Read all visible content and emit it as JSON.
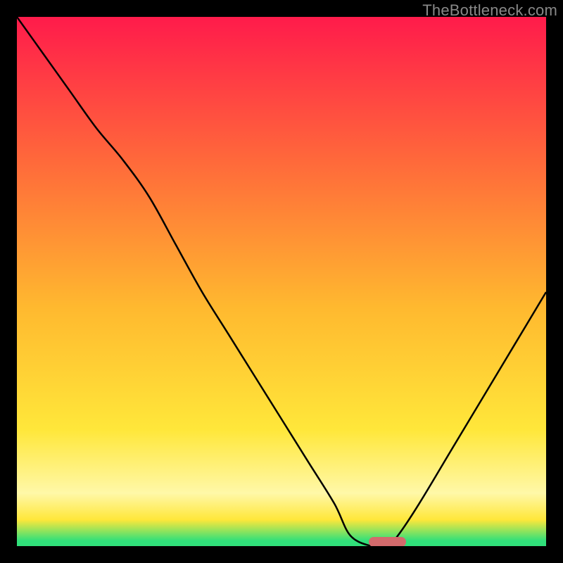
{
  "watermark": "TheBottleneck.com",
  "colors": {
    "top": "#ff1b4b",
    "mid1": "#ff6b3a",
    "mid2": "#ffb92f",
    "yellow": "#ffe73a",
    "pale": "#fff8a8",
    "green": "#30e07a",
    "marker": "#d36a6c",
    "curve": "#000000",
    "frame": "#000000"
  },
  "marker": {
    "x_pct": 66.5,
    "width_pct": 7.0
  },
  "chart_data": {
    "type": "line",
    "title": "",
    "xlabel": "",
    "ylabel": "",
    "xlim": [
      0,
      100
    ],
    "ylim": [
      0,
      100
    ],
    "legend": false,
    "grid": false,
    "series": [
      {
        "name": "curve",
        "x": [
          0,
          5,
          10,
          15,
          20,
          25,
          30,
          35,
          40,
          45,
          50,
          55,
          60,
          63,
          67,
          70,
          72,
          76,
          82,
          88,
          94,
          100
        ],
        "y": [
          100,
          93,
          86,
          79,
          73,
          66,
          57,
          48,
          40,
          32,
          24,
          16,
          8,
          2,
          0,
          0,
          2,
          8,
          18,
          28,
          38,
          48
        ]
      }
    ],
    "floor_marker": {
      "x_start": 63,
      "x_end": 70,
      "y": 0
    }
  }
}
